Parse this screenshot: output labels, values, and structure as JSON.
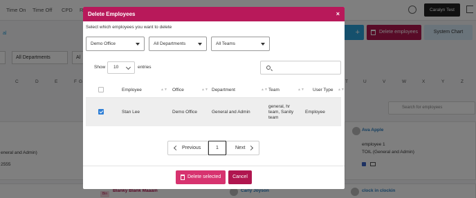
{
  "app": {
    "nav": [
      "Time On",
      "Time Off",
      "CPD",
      "Re"
    ],
    "user_label": "Caralyn Test",
    "delete_employees_label": "Delete employees",
    "system_chart_label": "System Chart",
    "add_plus": "+",
    "info_letter": "al",
    "filters": [
      "All Departments",
      "Al"
    ],
    "letters": [
      "C",
      "D",
      "E",
      "F",
      "G",
      "T",
      "U",
      "V",
      "W",
      "X",
      "Y",
      "Z"
    ],
    "search_placeholder": "Search for employees",
    "snippets": {
      "left_general": "eneral and Admin)",
      "left_num": "2555",
      "ava_name": "Ava Apple",
      "ava_role": "employee 1",
      "ava_toil": "TOIL (General and Admin)",
      "clock_name": "clock in clockin",
      "bin_tag": "Bin",
      "blanky": "Blanky Blank Maaain",
      "carly": "Carly Joyson"
    }
  },
  "modal": {
    "title": "Delete Employees",
    "close": "×",
    "instruction": "Select which employees you want to delete",
    "filters": {
      "office": "Demo Office",
      "department": "All Departments",
      "team": "All Teams"
    },
    "length": {
      "show_label": "Show",
      "value": "10",
      "entries_label": "entries"
    },
    "table": {
      "headers": [
        "Employee",
        "Office",
        "Department",
        "Team",
        "User Type"
      ],
      "rows": [
        {
          "checked": true,
          "employee": "Stan Lee",
          "office": "Demo Office",
          "department": "General and Admin",
          "team_lines": [
            "general, hr",
            "team, Sanity",
            "team"
          ],
          "user_type": "Employee"
        }
      ]
    },
    "pagination": {
      "previous": "Previous",
      "current": "1",
      "next": "Next"
    },
    "buttons": {
      "delete_selected": "Delete selected",
      "cancel": "Cancel"
    }
  }
}
